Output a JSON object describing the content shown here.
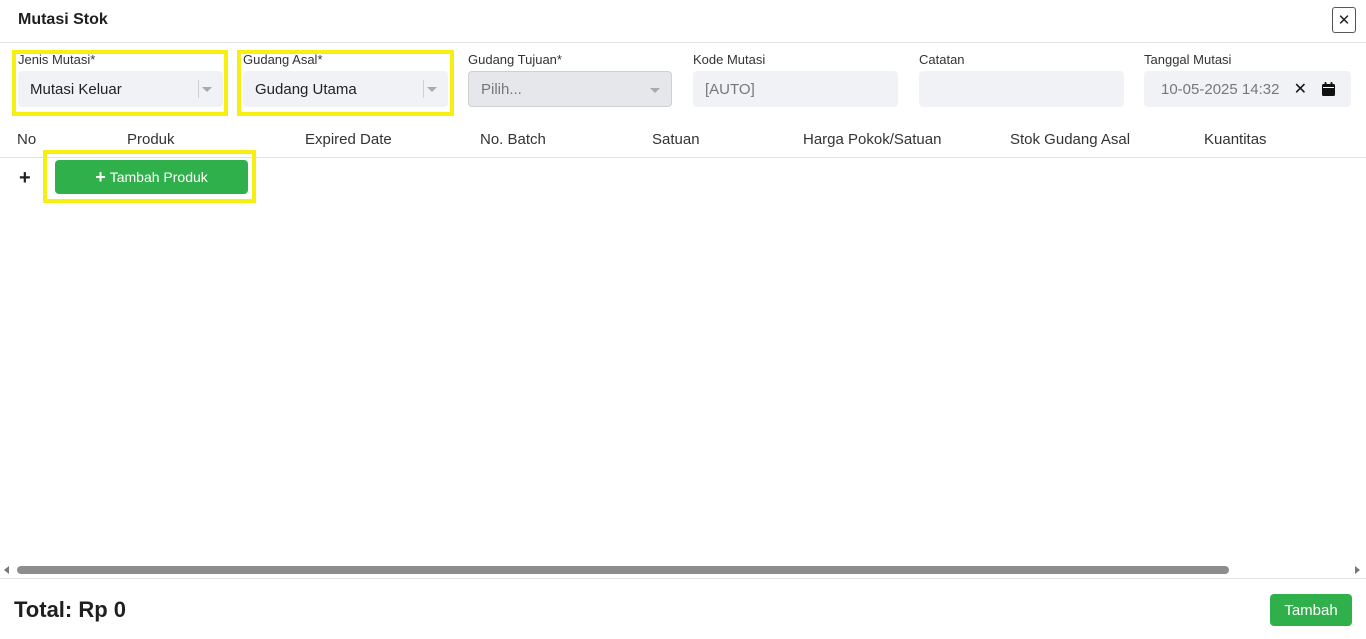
{
  "modal": {
    "title": "Mutasi Stok",
    "close_icon": "close-icon"
  },
  "form": {
    "jenis_mutasi": {
      "label": "Jenis Mutasi*",
      "value": "Mutasi Keluar"
    },
    "gudang_asal": {
      "label": "Gudang Asal*",
      "value": "Gudang Utama"
    },
    "gudang_tujuan": {
      "label": "Gudang Tujuan*",
      "placeholder": "Pilih..."
    },
    "kode_mutasi": {
      "label": "Kode Mutasi",
      "value": "[AUTO]"
    },
    "catatan": {
      "label": "Catatan",
      "value": ""
    },
    "tanggal_mutasi": {
      "label": "Tanggal Mutasi",
      "value": "10-05-2025 14:32"
    }
  },
  "table": {
    "columns": [
      "No",
      "Produk",
      "Expired Date",
      "No. Batch",
      "Satuan",
      "Harga Pokok/Satuan",
      "Stok Gudang Asal",
      "Kuantitas"
    ],
    "add_row_symbol": "+",
    "add_product_label": "Tambah Produk",
    "add_product_plus": "+"
  },
  "footer": {
    "total_label": "Total: Rp 0",
    "submit_label": "Tambah"
  },
  "colors": {
    "accent_green": "#2fb04a",
    "highlight_yellow": "#f6ef10"
  }
}
